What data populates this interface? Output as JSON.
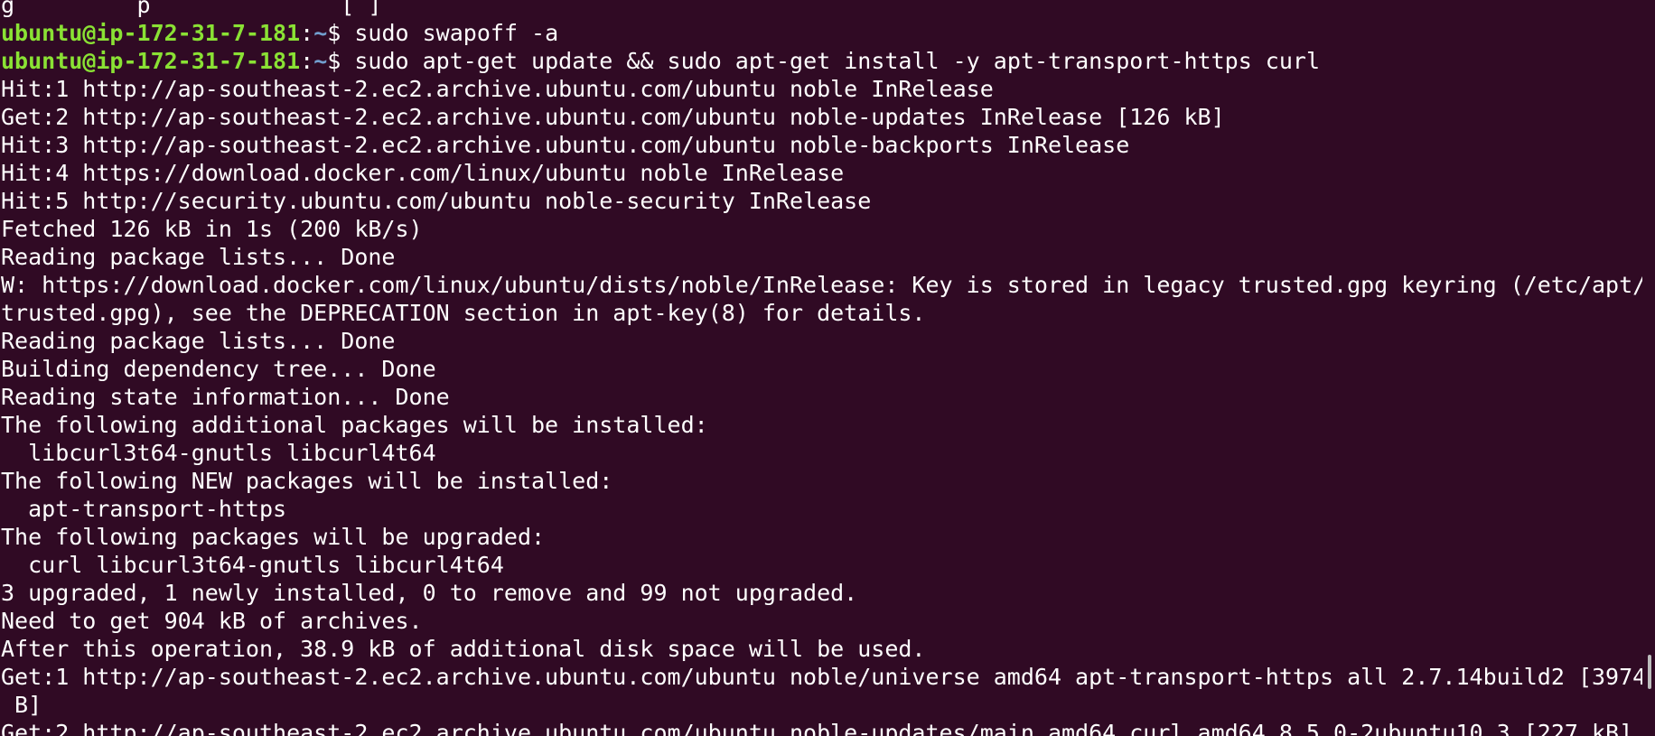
{
  "prompt": {
    "user_host": "ubuntu@ip-172-31-7-181",
    "colon": ":",
    "path": "~",
    "dollar": "$ "
  },
  "partial_top_line": "g         p              [ ]",
  "commands": [
    "sudo swapoff -a",
    "sudo apt-get update && sudo apt-get install -y apt-transport-https curl"
  ],
  "output_lines": [
    "Hit:1 http://ap-southeast-2.ec2.archive.ubuntu.com/ubuntu noble InRelease",
    "Get:2 http://ap-southeast-2.ec2.archive.ubuntu.com/ubuntu noble-updates InRelease [126 kB]",
    "Hit:3 http://ap-southeast-2.ec2.archive.ubuntu.com/ubuntu noble-backports InRelease",
    "Hit:4 https://download.docker.com/linux/ubuntu noble InRelease",
    "Hit:5 http://security.ubuntu.com/ubuntu noble-security InRelease",
    "Fetched 126 kB in 1s (200 kB/s)",
    "Reading package lists... Done",
    "W: https://download.docker.com/linux/ubuntu/dists/noble/InRelease: Key is stored in legacy trusted.gpg keyring (/etc/apt/",
    "trusted.gpg), see the DEPRECATION section in apt-key(8) for details.",
    "Reading package lists... Done",
    "Building dependency tree... Done",
    "Reading state information... Done",
    "The following additional packages will be installed:",
    "  libcurl3t64-gnutls libcurl4t64",
    "The following NEW packages will be installed:",
    "  apt-transport-https",
    "The following packages will be upgraded:",
    "  curl libcurl3t64-gnutls libcurl4t64",
    "3 upgraded, 1 newly installed, 0 to remove and 99 not upgraded.",
    "Need to get 904 kB of archives.",
    "After this operation, 38.9 kB of additional disk space will be used.",
    "Get:1 http://ap-southeast-2.ec2.archive.ubuntu.com/ubuntu noble/universe amd64 apt-transport-https all 2.7.14build2 [3974",
    " B]",
    "Get:2 http://ap-southeast-2.ec2.archive.ubuntu.com/ubuntu noble-updates/main amd64 curl amd64 8.5.0-2ubuntu10.3 [227 kB]"
  ],
  "colors": {
    "background": "#300a24",
    "user_host": "#8ae234",
    "path": "#729fcf",
    "text": "#ffffff"
  }
}
